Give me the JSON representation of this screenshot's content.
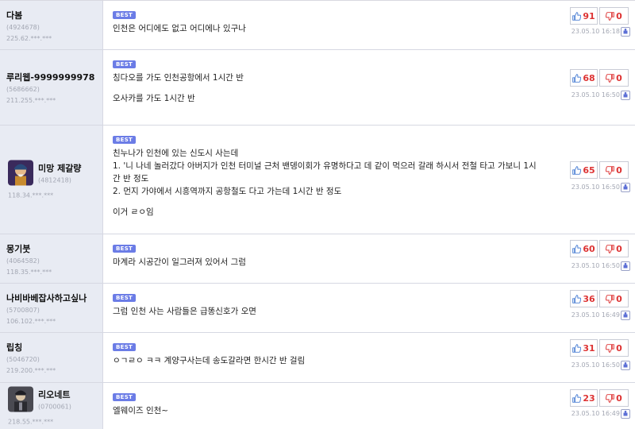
{
  "comments": [
    {
      "nick": "다봄",
      "uid": "(4924678)",
      "ip": "225.62.***.***",
      "badge": "BEST",
      "lines": [
        "인천은 어디에도 없고 어디에나 있구나"
      ],
      "up": "91",
      "down": "0",
      "date": "23.05.10 16:18",
      "avatar": null
    },
    {
      "nick": "루리웹-9999999978",
      "uid": "(5686662)",
      "ip": "211.255.***.***",
      "badge": "BEST",
      "lines": [
        "칭다오를 가도 인천공항에서 1시간 반",
        "",
        "오사카를 가도 1시간 반"
      ],
      "up": "68",
      "down": "0",
      "date": "23.05.10 16:50",
      "avatar": null
    },
    {
      "nick": "미망 제갈량",
      "uid": "(4812418)",
      "ip": "118.34.***.***",
      "badge": "BEST",
      "lines": [
        "친누나가 인천에 있는 신도시 사는데",
        "1. '니 나네 놀러갔다 아버지가 인천 터미널 근처 밴뎅이회가 유명하다고 데 같이 먹으러 갈래 하시서 전철 타고 가보니 1시",
        "간 반 정도",
        "2. 먼지 가야에서 시흥역까지 공항철도 다고 가는데 1시간 반 정도",
        "",
        "이거 ㄹㅇ임"
      ],
      "up": "65",
      "down": "0",
      "date": "23.05.10 16:50",
      "avatar": "general"
    },
    {
      "nick": "몽기붓",
      "uid": "(4064582)",
      "ip": "118.35.***.***",
      "badge": "BEST",
      "lines": [
        "마계라 시공간이 일그러져 있어서 그럼"
      ],
      "up": "60",
      "down": "0",
      "date": "23.05.10 16:50",
      "avatar": null
    },
    {
      "nick": "나비바베잡사하고싶나",
      "uid": "(5700807)",
      "ip": "106.102.***.***",
      "badge": "BEST",
      "lines": [
        "그럼 인천 사는 사람들은 급똥신호가 오면"
      ],
      "up": "36",
      "down": "0",
      "date": "23.05.10 16:49",
      "avatar": null
    },
    {
      "nick": "립칭",
      "uid": "(5046720)",
      "ip": "219.200.***.***",
      "badge": "BEST",
      "lines": [
        "ㅇㄱㄹㅇ ㅋㅋ 계양구사는데 송도갈라면 한시간 반 걸림"
      ],
      "up": "31",
      "down": "0",
      "date": "23.05.10 16:50",
      "avatar": null
    },
    {
      "nick": "리오네트",
      "uid": "(0700061)",
      "ip": "218.55.***.***",
      "badge": "BEST",
      "lines": [
        "엘웨이즈 인천~"
      ],
      "up": "23",
      "down": "0",
      "date": "23.05.10 16:49",
      "avatar": "knight"
    }
  ],
  "colors": {
    "badge": "#6b7ce6",
    "vote_number": "#dd3333",
    "thumb_up": "#4a7fd4",
    "thumb_down": "#d33333",
    "user_panel": "#e8ebf3"
  },
  "icons": {
    "up": "thumbs-up-icon",
    "down": "thumbs-down-icon",
    "reply": "reply-icon"
  }
}
